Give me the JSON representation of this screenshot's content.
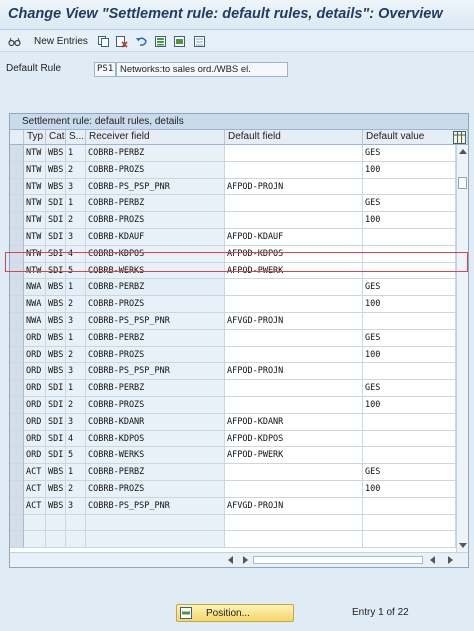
{
  "window": {
    "title": "Change View \"Settlement rule: default rules, details\": Overview"
  },
  "toolbar": {
    "new_entries_label": "New Entries",
    "icons": [
      "glasses-icon",
      "copy-icon",
      "delete-icon",
      "undo-icon",
      "select-all-icon",
      "select-block-icon",
      "deselect-all-icon"
    ]
  },
  "default_rule": {
    "label": "Default Rule",
    "code": "PS1",
    "description": "Networks:to sales ord./WBS el."
  },
  "table": {
    "caption": "Settlement rule: default rules, details",
    "columns": {
      "typ": "Typ",
      "cat": "Cat",
      "s": "S...",
      "receiver": "Receiver field",
      "default_field": "Default field",
      "default_value": "Default value"
    },
    "rows": [
      {
        "typ": "NTW",
        "cat": "WBS",
        "s": "1",
        "receiver": "COBRB-PERBZ",
        "default_field": "",
        "default_value": "GES"
      },
      {
        "typ": "NTW",
        "cat": "WBS",
        "s": "2",
        "receiver": "COBRB-PROZS",
        "default_field": "",
        "default_value": "100"
      },
      {
        "typ": "NTW",
        "cat": "WBS",
        "s": "3",
        "receiver": "COBRB-PS_PSP_PNR",
        "default_field": "AFPOD-PROJN",
        "default_value": ""
      },
      {
        "typ": "NTW",
        "cat": "SDI",
        "s": "1",
        "receiver": "COBRB-PERBZ",
        "default_field": "",
        "default_value": "GES"
      },
      {
        "typ": "NTW",
        "cat": "SDI",
        "s": "2",
        "receiver": "COBRB-PROZS",
        "default_field": "",
        "default_value": "100"
      },
      {
        "typ": "NTW",
        "cat": "SDI",
        "s": "3",
        "receiver": "COBRB-KDAUF",
        "default_field": "AFPOD-KDAUF",
        "default_value": ""
      },
      {
        "typ": "NTW",
        "cat": "SDI",
        "s": "4",
        "receiver": "COBRB-KDPOS",
        "default_field": "AFPOD-KDPOS",
        "default_value": ""
      },
      {
        "typ": "NTW",
        "cat": "SDI",
        "s": "5",
        "receiver": "COBRB-WERKS",
        "default_field": "AFPOD-PWERK",
        "default_value": ""
      },
      {
        "typ": "NWA",
        "cat": "WBS",
        "s": "1",
        "receiver": "COBRB-PERBZ",
        "default_field": "",
        "default_value": "GES"
      },
      {
        "typ": "NWA",
        "cat": "WBS",
        "s": "2",
        "receiver": "COBRB-PROZS",
        "default_field": "",
        "default_value": "100"
      },
      {
        "typ": "NWA",
        "cat": "WBS",
        "s": "3",
        "receiver": "COBRB-PS_PSP_PNR",
        "default_field": "AFVGD-PROJN",
        "default_value": ""
      },
      {
        "typ": "ORD",
        "cat": "WBS",
        "s": "1",
        "receiver": "COBRB-PERBZ",
        "default_field": "",
        "default_value": "GES"
      },
      {
        "typ": "ORD",
        "cat": "WBS",
        "s": "2",
        "receiver": "COBRB-PROZS",
        "default_field": "",
        "default_value": "100"
      },
      {
        "typ": "ORD",
        "cat": "WBS",
        "s": "3",
        "receiver": "COBRB-PS_PSP_PNR",
        "default_field": "AFPOD-PROJN",
        "default_value": ""
      },
      {
        "typ": "ORD",
        "cat": "SDI",
        "s": "1",
        "receiver": "COBRB-PERBZ",
        "default_field": "",
        "default_value": "GES"
      },
      {
        "typ": "ORD",
        "cat": "SDI",
        "s": "2",
        "receiver": "COBRB-PROZS",
        "default_field": "",
        "default_value": "100"
      },
      {
        "typ": "ORD",
        "cat": "SDI",
        "s": "3",
        "receiver": "COBRB-KDANR",
        "default_field": "AFPOD-KDANR",
        "default_value": ""
      },
      {
        "typ": "ORD",
        "cat": "SDI",
        "s": "4",
        "receiver": "COBRB-KDPOS",
        "default_field": "AFPOD-KDPOS",
        "default_value": ""
      },
      {
        "typ": "ORD",
        "cat": "SDI",
        "s": "5",
        "receiver": "COBRB-WERKS",
        "default_field": "AFPOD-PWERK",
        "default_value": ""
      },
      {
        "typ": "ACT",
        "cat": "WBS",
        "s": "1",
        "receiver": "COBRB-PERBZ",
        "default_field": "",
        "default_value": "GES"
      },
      {
        "typ": "ACT",
        "cat": "WBS",
        "s": "2",
        "receiver": "COBRB-PROZS",
        "default_field": "",
        "default_value": "100"
      },
      {
        "typ": "ACT",
        "cat": "WBS",
        "s": "3",
        "receiver": "COBRB-PS_PSP_PNR",
        "default_field": "AFVGD-PROJN",
        "default_value": ""
      },
      {
        "typ": "",
        "cat": "",
        "s": "",
        "receiver": "",
        "default_field": "",
        "default_value": ""
      },
      {
        "typ": "",
        "cat": "",
        "s": "",
        "receiver": "",
        "default_field": "",
        "default_value": ""
      }
    ],
    "highlighted_row": 8
  },
  "footer": {
    "position_label": "Position...",
    "entry_info": "Entry 1 of 22"
  },
  "colors": {
    "highlight": "#d8474b",
    "title": "#213d62",
    "button": "#f3d66a"
  }
}
